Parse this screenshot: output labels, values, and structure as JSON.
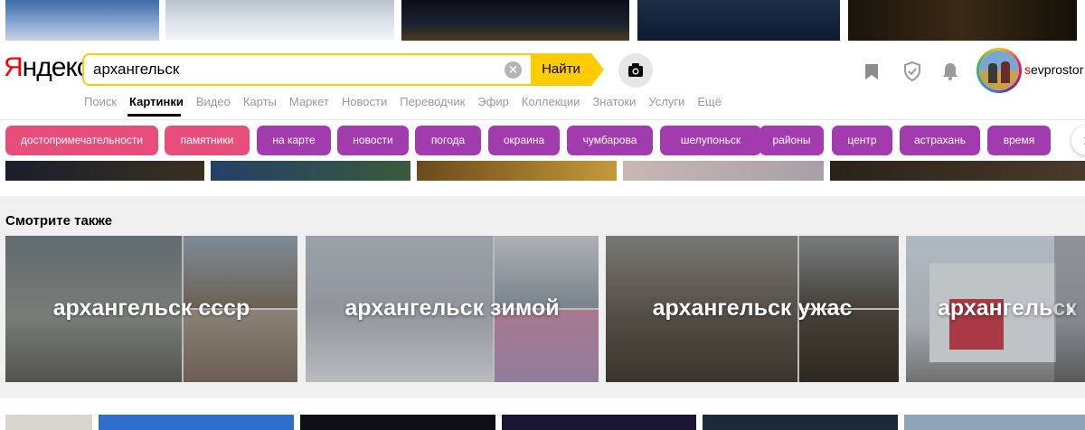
{
  "header": {
    "logo": {
      "first": "Я",
      "rest": "ндекс"
    },
    "search": {
      "value": "архангельск",
      "placeholder": ""
    },
    "find_label": "Найти",
    "user": {
      "first": "s",
      "rest": "evprostor"
    }
  },
  "nav": {
    "items": [
      "Поиск",
      "Картинки",
      "Видео",
      "Карты",
      "Маркет",
      "Новости",
      "Переводчик",
      "Эфир",
      "Коллекции",
      "Знатоки",
      "Услуги",
      "Ещё"
    ],
    "active": "Картинки"
  },
  "chips": [
    {
      "label": "достопримечательности",
      "color": "#e84e7c"
    },
    {
      "label": "памятники",
      "color": "#e84e7c"
    },
    {
      "label": "на карте",
      "color": "#a23cae"
    },
    {
      "label": "новости",
      "color": "#a23cae"
    },
    {
      "label": "погода",
      "color": "#a23cae"
    },
    {
      "label": "окраина",
      "color": "#a23cae"
    },
    {
      "label": "чумбарова",
      "color": "#a23cae"
    },
    {
      "label": "шелупоньск",
      "color": "#a23cae"
    },
    {
      "label": "районы",
      "color": "#a23cae"
    },
    {
      "label": "центр",
      "color": "#a23cae"
    },
    {
      "label": "астрахань",
      "color": "#a23cae"
    },
    {
      "label": "время",
      "color": "#a23cae"
    }
  ],
  "see_also": {
    "title": "Смотрите также",
    "cards": [
      {
        "label": "архангельск ссср"
      },
      {
        "label": "архангельск зимой"
      },
      {
        "label": "архангельск ужас"
      },
      {
        "label": "архангельск"
      }
    ]
  },
  "icons": {
    "clear": "clear-icon",
    "camera": "camera-icon",
    "bookmark": "bookmark-icon",
    "shield": "shield-icon",
    "bell": "bell-icon",
    "chevron": "chevron-right-icon"
  },
  "colors": {
    "accent": "#fc0",
    "logo_red": "#f00",
    "chip_pink": "#e84e7c",
    "chip_purple": "#a23cae"
  }
}
